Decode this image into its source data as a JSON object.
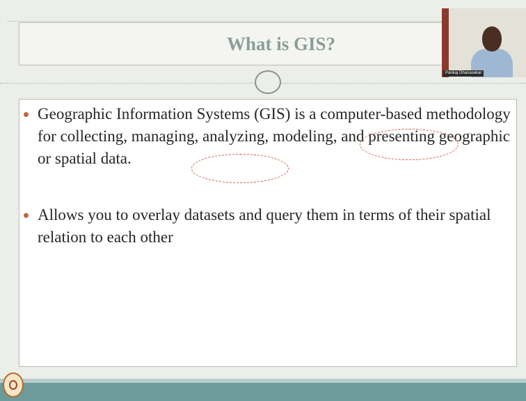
{
  "slide": {
    "title": "What is GIS?",
    "bullets": [
      "Geographic Information Systems (GIS) is a computer-based methodology for collecting, managing, analyzing, modeling, and presenting geographic or spatial data.",
      "Allows you to overlay datasets and query them in terms of their spatial relation to each other"
    ],
    "highlighted_terms": [
      "modeling,",
      "spatial data"
    ]
  },
  "webcam": {
    "presenter_name": "Pankaj Dhanasekar"
  },
  "colors": {
    "title": "#8a9e9a",
    "bullet": "#c0663e",
    "annotation": "#d45a4a",
    "footer": "#6d9a9a"
  }
}
